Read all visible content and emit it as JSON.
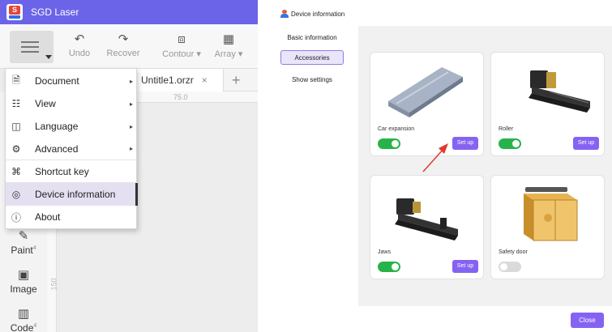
{
  "app": {
    "title": "SGD Laser",
    "toolbar": {
      "undo": "Undo",
      "recover": "Recover",
      "contour": "Contour",
      "array": "Array"
    },
    "tab": {
      "name": "Untitle1.orzr",
      "close": "×",
      "add": "+"
    },
    "ruler_label": "75.0",
    "vruler_label": "150",
    "side_tools": {
      "paint": "Paint",
      "image": "Image",
      "code": "Code"
    },
    "menu": [
      {
        "label": "Document",
        "icon": "document-icon",
        "submenu": true
      },
      {
        "label": "View",
        "icon": "view-icon",
        "submenu": true
      },
      {
        "label": "Language",
        "icon": "language-icon",
        "submenu": true
      },
      {
        "label": "Advanced",
        "icon": "advanced-icon",
        "submenu": true
      },
      {
        "label": "Shortcut key",
        "icon": "command-icon",
        "submenu": false
      },
      {
        "label": "Device information",
        "icon": "device-icon",
        "submenu": false,
        "active": true
      },
      {
        "label": "About",
        "icon": "info-icon",
        "submenu": false
      }
    ]
  },
  "dialog": {
    "title": "Device information",
    "nav": [
      "Basic information",
      "Accessories",
      "Show settings"
    ],
    "cards": [
      {
        "name": "Car expansion",
        "enabled": true,
        "setup": "Set up"
      },
      {
        "name": "Roller",
        "enabled": true,
        "setup": "Set up"
      },
      {
        "name": "Jaws",
        "enabled": true,
        "setup": "Set up"
      },
      {
        "name": "Safety door",
        "enabled": false
      }
    ],
    "close": "Close"
  },
  "colors": {
    "accent": "#6b63e8",
    "button": "#8563f2",
    "toggle_on": "#27b34a",
    "arrow": "#e03a2e"
  }
}
